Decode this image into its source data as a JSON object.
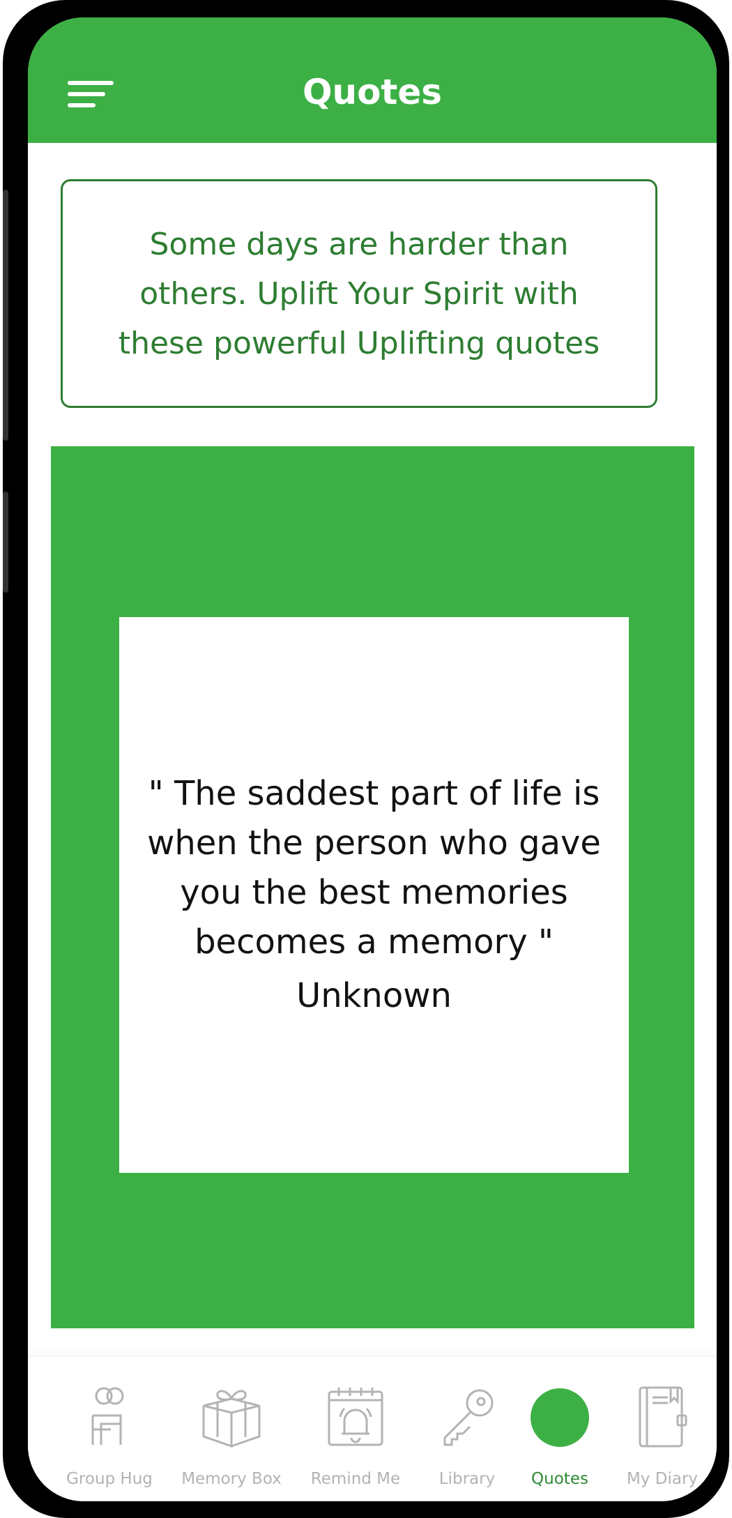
{
  "header": {
    "title": "Quotes",
    "menu_icon": "hamburger-menu-icon"
  },
  "intro": {
    "text": "Some days are harder than others. Uplift Your Spirit with these powerful Uplifting quotes"
  },
  "quote": {
    "text": "\" The saddest part of life is when the person who gave you the best memories becomes a memory \"",
    "author": "Unknown"
  },
  "bottom_nav": {
    "items": [
      {
        "label": "Group Hug",
        "icon": "group-hug-icon"
      },
      {
        "label": "Memory Box",
        "icon": "gift-box-icon"
      },
      {
        "label": "Remind Me",
        "icon": "bell-calendar-icon"
      },
      {
        "label": "Library",
        "icon": "key-icon"
      },
      {
        "label": "Quotes",
        "icon": "quotes-icon",
        "active": true
      },
      {
        "label": "My Diary",
        "icon": "diary-icon"
      }
    ]
  },
  "colors": {
    "primary_green": "#3cb045",
    "dark_green_text": "#2e7d32",
    "inactive_gray": "#b3b3b3"
  }
}
